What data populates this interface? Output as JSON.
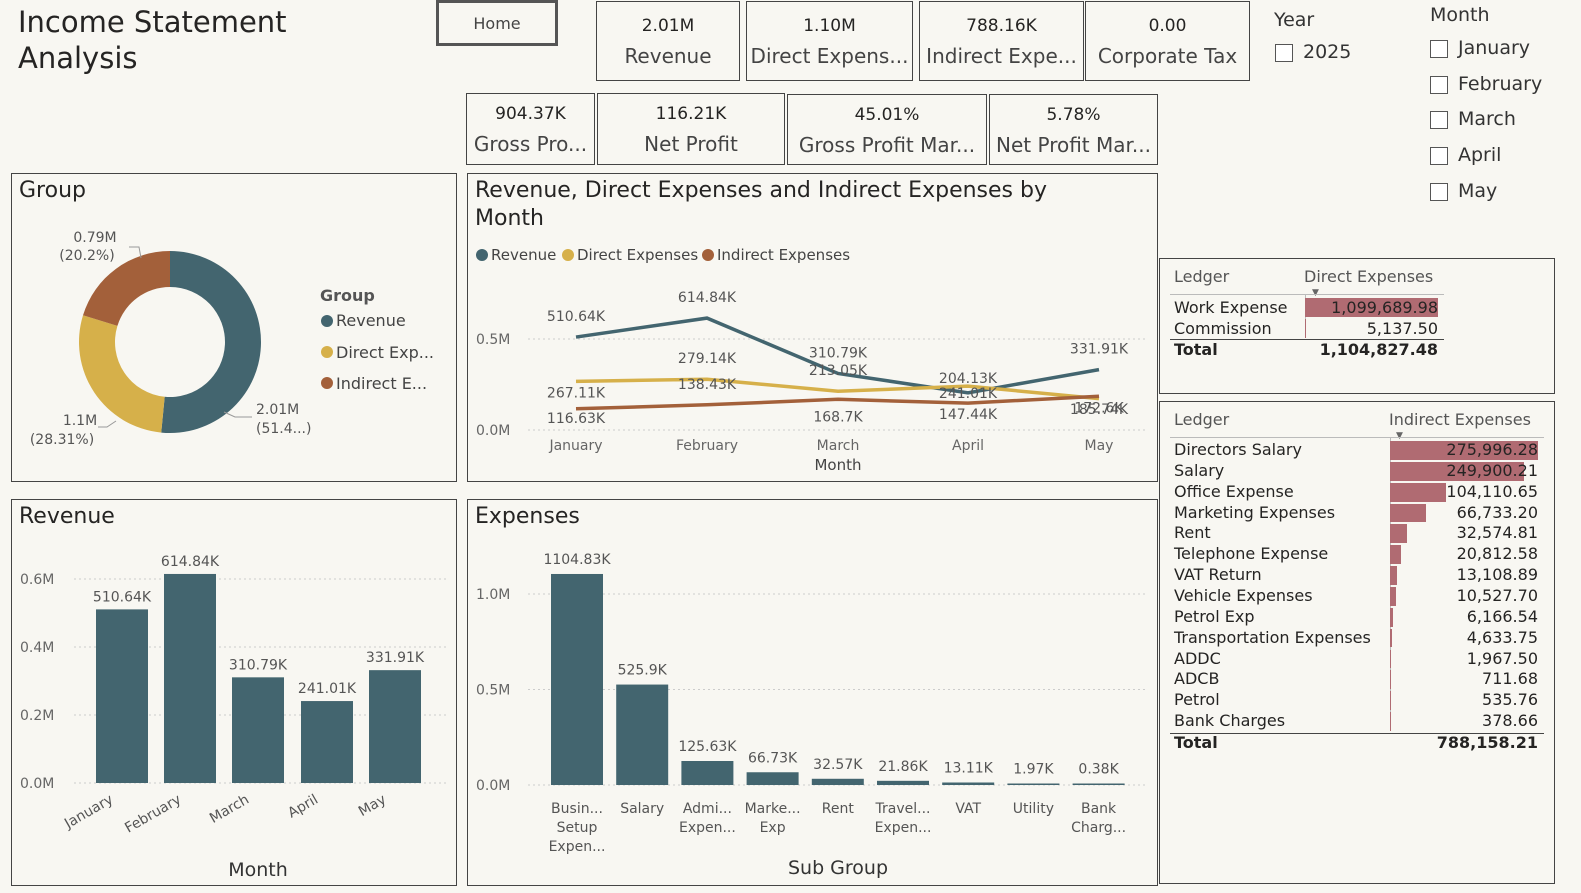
{
  "title_line1": "Income Statement",
  "title_line2": "Analysis",
  "home_label": "Home",
  "kpis_row1": [
    {
      "value": "2.01M",
      "label": "Revenue"
    },
    {
      "value": "1.10M",
      "label": "Direct Expens..."
    },
    {
      "value": "788.16K",
      "label": "Indirect Expe..."
    },
    {
      "value": "0.00",
      "label": "Corporate Tax"
    }
  ],
  "kpis_row2": [
    {
      "value": "904.37K",
      "label": "Gross Pro..."
    },
    {
      "value": "116.21K",
      "label": "Net Profit"
    },
    {
      "value": "45.01%",
      "label": "Gross Profit Mar..."
    },
    {
      "value": "5.78%",
      "label": "Net Profit Mar..."
    }
  ],
  "year_slicer": {
    "title": "Year",
    "items": [
      "2025"
    ]
  },
  "month_slicer": {
    "title": "Month",
    "items": [
      "January",
      "February",
      "March",
      "April",
      "May"
    ]
  },
  "colors": {
    "revenue": "#43656f",
    "direct": "#d6b04a",
    "indirect": "#a3603a",
    "bar": "#43656f",
    "databar": "#b06b72"
  },
  "group_chart": {
    "title": "Group",
    "legend_title": "Group",
    "legend_items": [
      "Revenue",
      "Direct Exp...",
      "Indirect E..."
    ],
    "labels": [
      {
        "line1": "0.79M",
        "line2": "(20.2%)"
      },
      {
        "line1": "1.1M",
        "line2": "(28.31%)"
      },
      {
        "line1": "2.01M",
        "line2": "(51.4...)"
      }
    ]
  },
  "line_chart": {
    "title_line1": "Revenue, Direct Expenses and Indirect Expenses by",
    "title_line2": "Month",
    "legend": [
      "Revenue",
      "Direct Expenses",
      "Indirect Expenses"
    ],
    "xlabel": "Month",
    "y_ticks": [
      "0.5M",
      "0.0M"
    ],
    "revenue_labels": [
      "510.64K",
      "614.84K",
      "310.79K",
      "204.13K",
      "331.91K"
    ],
    "direct_labels": [
      "267.11K",
      "279.14K",
      "213.05K",
      "241.01K",
      "172.6K"
    ],
    "indirect_labels": [
      "116.63K",
      "138.43K",
      "168.7K",
      "147.44K",
      "185.74K"
    ]
  },
  "revenue_chart": {
    "title": "Revenue",
    "xlabel": "Month",
    "y_ticks": [
      "0.6M",
      "0.4M",
      "0.2M",
      "0.0M"
    ],
    "value_labels": [
      "510.64K",
      "614.84K",
      "310.79K",
      "241.01K",
      "331.91K"
    ]
  },
  "expenses_chart": {
    "title": "Expenses",
    "xlabel": "Sub Group",
    "y_ticks": [
      "1.0M",
      "0.5M",
      "0.0M"
    ],
    "value_labels": [
      "1104.83K",
      "525.9K",
      "125.63K",
      "66.73K",
      "32.57K",
      "21.86K",
      "13.11K",
      "1.97K",
      "0.38K"
    ],
    "category_lines": [
      [
        "Busin...",
        "Setup",
        "Expen..."
      ],
      [
        "Salary"
      ],
      [
        "Admi...",
        "Expen..."
      ],
      [
        "Marke...",
        "Exp"
      ],
      [
        "Rent"
      ],
      [
        "Travel...",
        "Expen..."
      ],
      [
        "VAT"
      ],
      [
        "Utility"
      ],
      [
        "Bank",
        "Charg..."
      ]
    ]
  },
  "direct_table": {
    "col1": "Ledger",
    "col2": "Direct Expenses",
    "rows": [
      {
        "ledger": "Work Expense",
        "value": "1,099,689.98",
        "num": 1099689.98
      },
      {
        "ledger": "Commission",
        "value": "5,137.50",
        "num": 5137.5
      }
    ],
    "total_label": "Total",
    "total_value": "1,104,827.48"
  },
  "indirect_table": {
    "col1": "Ledger",
    "col2": "Indirect Expenses",
    "rows": [
      {
        "ledger": "Directors Salary",
        "value": "275,996.28",
        "num": 275996.28
      },
      {
        "ledger": "Salary",
        "value": "249,900.21",
        "num": 249900.21
      },
      {
        "ledger": "Office Expense",
        "value": "104,110.65",
        "num": 104110.65
      },
      {
        "ledger": "Marketing Expenses",
        "value": "66,733.20",
        "num": 66733.2
      },
      {
        "ledger": "Rent",
        "value": "32,574.81",
        "num": 32574.81
      },
      {
        "ledger": "Telephone Expense",
        "value": "20,812.58",
        "num": 20812.58
      },
      {
        "ledger": "VAT Return",
        "value": "13,108.89",
        "num": 13108.89
      },
      {
        "ledger": "Vehicle Expenses",
        "value": "10,527.70",
        "num": 10527.7
      },
      {
        "ledger": "Petrol Exp",
        "value": "6,166.54",
        "num": 6166.54
      },
      {
        "ledger": "Transportation Expenses",
        "value": "4,633.75",
        "num": 4633.75
      },
      {
        "ledger": "ADDC",
        "value": "1,967.50",
        "num": 1967.5
      },
      {
        "ledger": "ADCB",
        "value": "711.68",
        "num": 711.68
      },
      {
        "ledger": "Petrol",
        "value": "535.76",
        "num": 535.76
      },
      {
        "ledger": "Bank Charges",
        "value": "378.66",
        "num": 378.66
      }
    ],
    "total_label": "Total",
    "total_value": "788,158.21"
  },
  "chart_data": [
    {
      "type": "pie",
      "title": "Group",
      "categories": [
        "Revenue",
        "Direct Expenses",
        "Indirect Expenses"
      ],
      "values": [
        2.01,
        1.1,
        0.79
      ],
      "percent": [
        51.4,
        28.31,
        20.2
      ],
      "legend": "right"
    },
    {
      "type": "line",
      "title": "Revenue, Direct Expenses and Indirect Expenses by Month",
      "xlabel": "Month",
      "categories": [
        "January",
        "February",
        "March",
        "April",
        "May"
      ],
      "series": [
        {
          "name": "Revenue",
          "values": [
            510.64,
            614.84,
            310.79,
            204.13,
            331.91
          ]
        },
        {
          "name": "Direct Expenses",
          "values": [
            267.11,
            279.14,
            213.05,
            241.01,
            172.6
          ]
        },
        {
          "name": "Indirect Expenses",
          "values": [
            116.63,
            138.43,
            168.7,
            147.44,
            185.74
          ]
        }
      ],
      "ylim": [
        0,
        0.7
      ],
      "legend": "top-left"
    },
    {
      "type": "bar",
      "title": "Revenue",
      "xlabel": "Month",
      "categories": [
        "January",
        "February",
        "March",
        "April",
        "May"
      ],
      "values": [
        510.64,
        614.84,
        310.79,
        241.01,
        331.91
      ],
      "ylim": [
        0,
        0.6
      ]
    },
    {
      "type": "bar",
      "title": "Expenses",
      "xlabel": "Sub Group",
      "categories": [
        "Business Setup Expenses",
        "Salary",
        "Admin Expenses",
        "Marketing Exp",
        "Rent",
        "Travel Expenses",
        "VAT",
        "Utility",
        "Bank Charges"
      ],
      "values": [
        1104.83,
        525.9,
        125.63,
        66.73,
        32.57,
        21.86,
        13.11,
        1.97,
        0.38
      ],
      "ylim": [
        0,
        1.0
      ]
    }
  ]
}
